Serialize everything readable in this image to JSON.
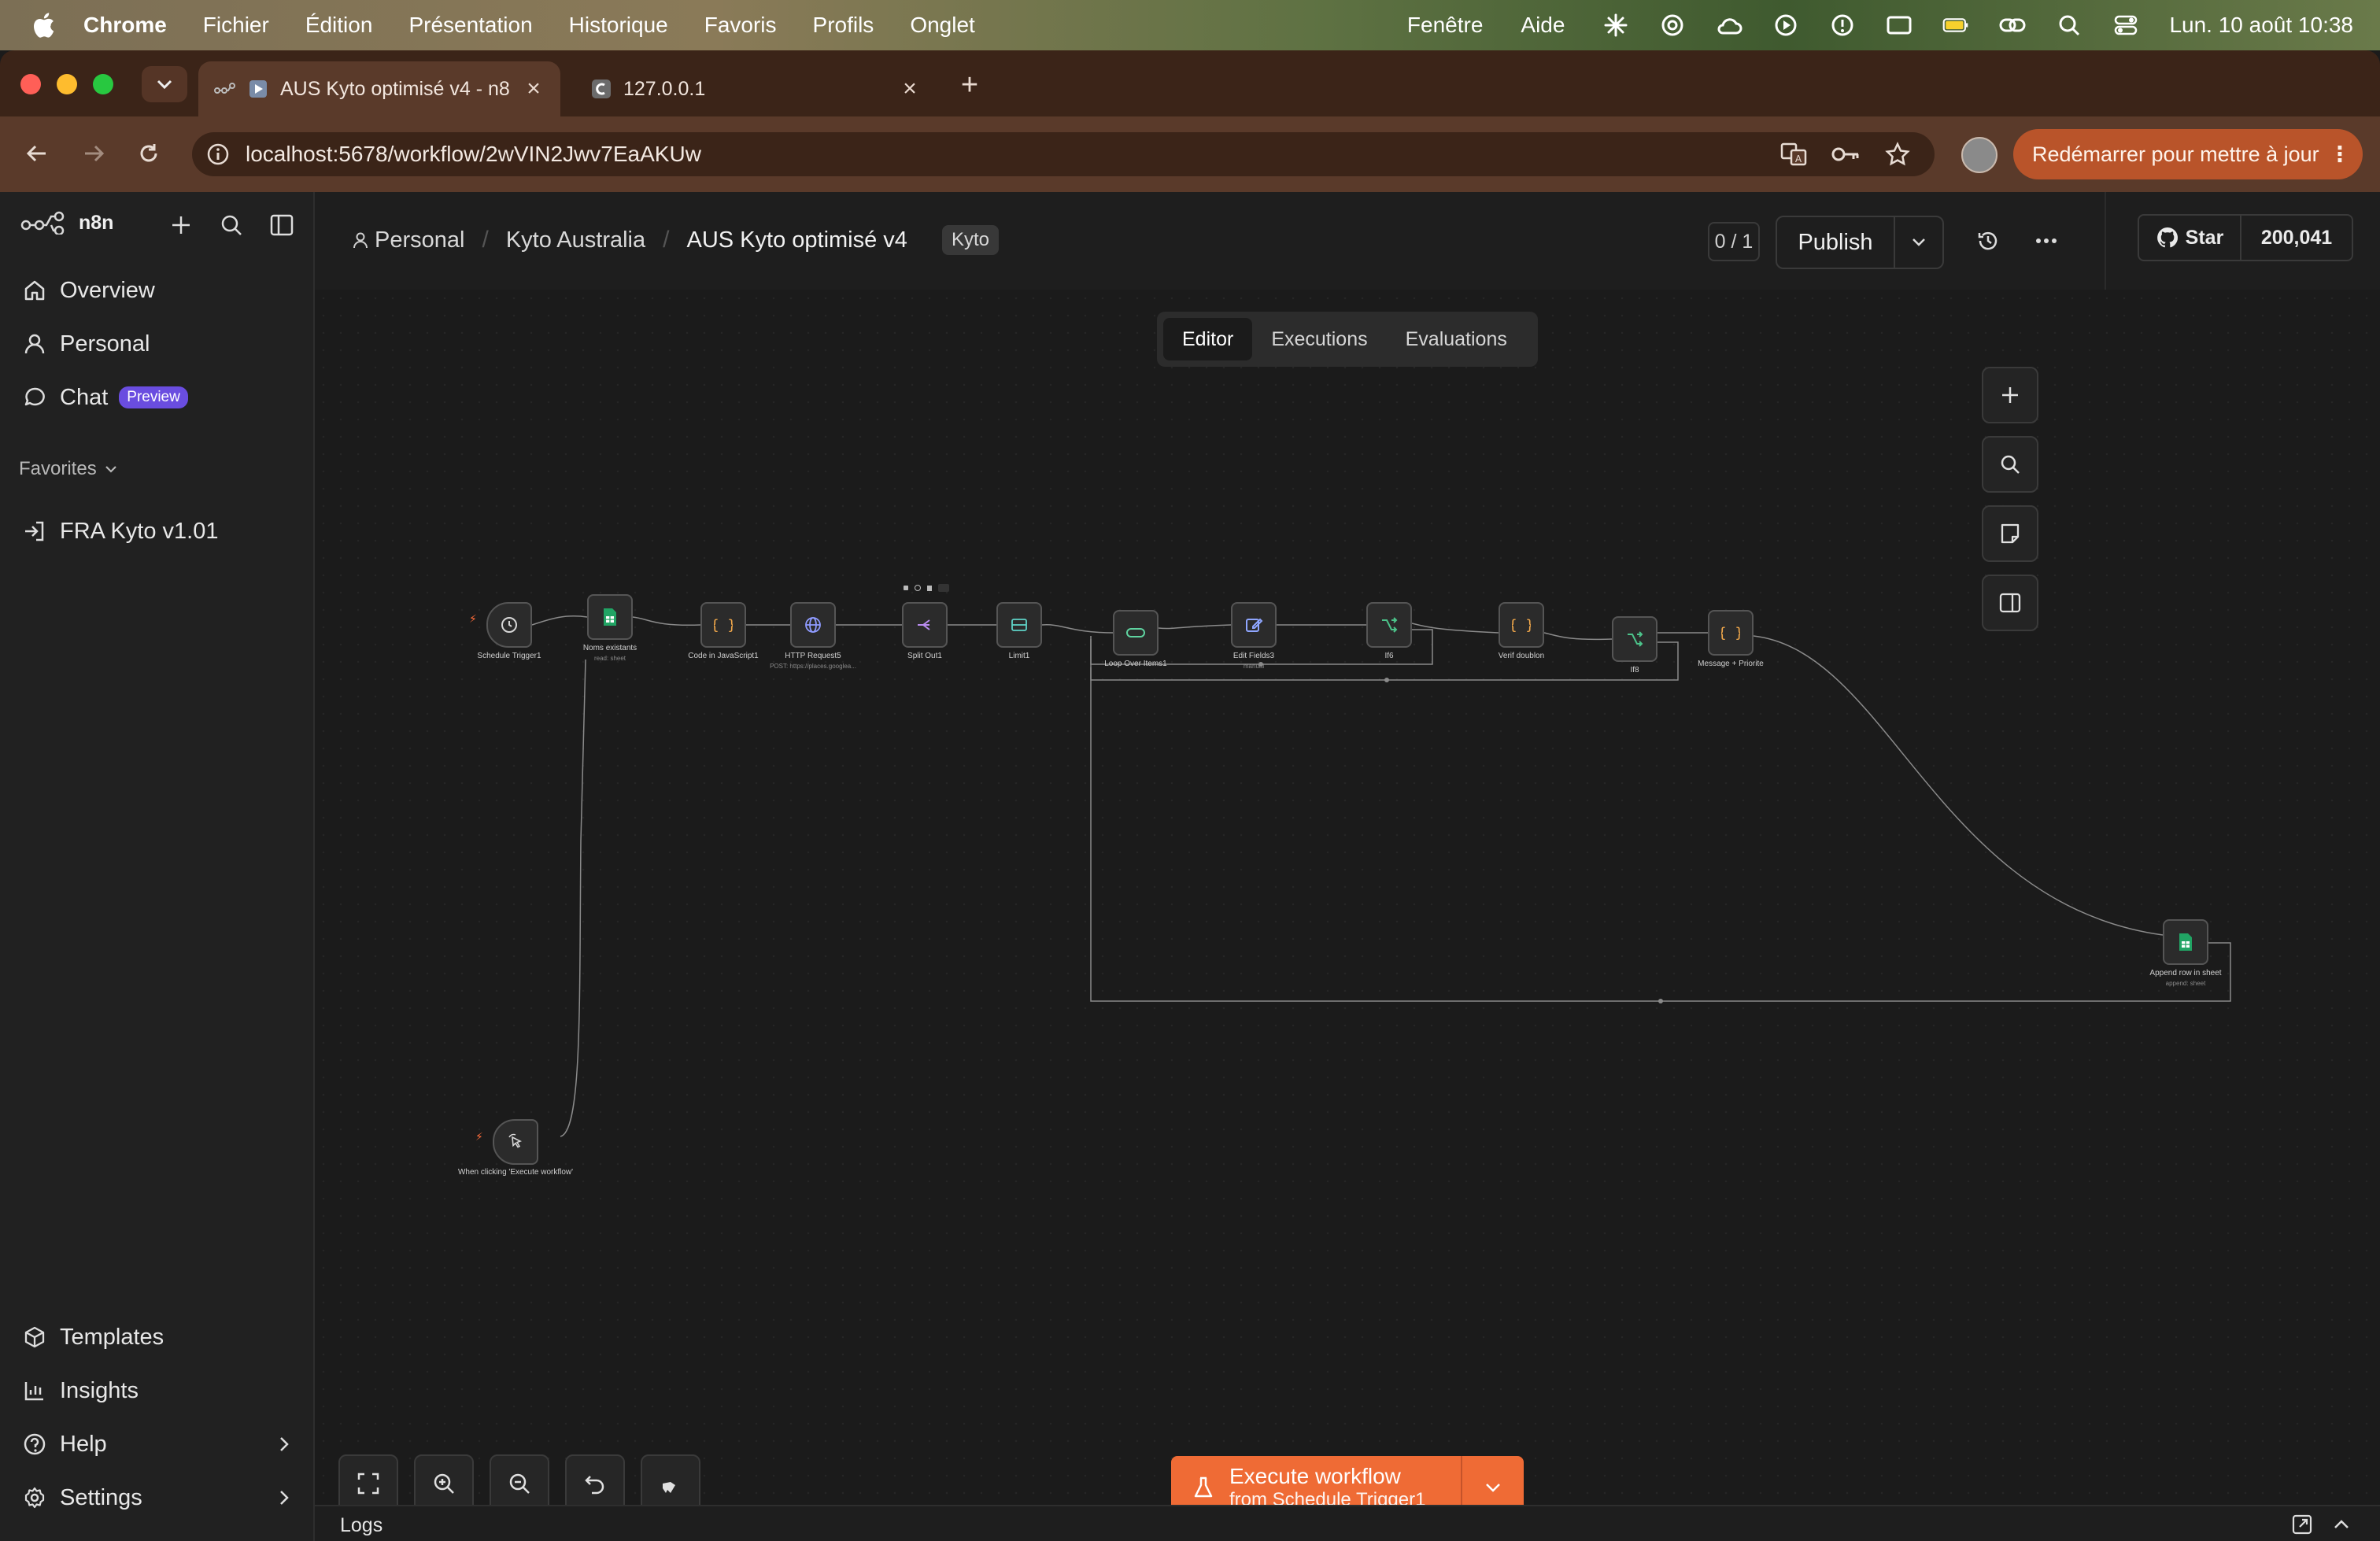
{
  "colors": {
    "accent": "#ef6b35",
    "menubar": "#6a6a45",
    "tabstrip": "#3b2418",
    "toolbar": "#5a3a2a",
    "canvas_bg": "#1b1b1b",
    "relaunch": "#b9542a",
    "preview_badge": "#6a4de0"
  },
  "menubar": {
    "app_name": "Chrome",
    "items": [
      "Fichier",
      "Édition",
      "Présentation",
      "Historique",
      "Favoris",
      "Profils",
      "Onglet"
    ],
    "right_items": [
      "Fenêtre",
      "Aide"
    ],
    "status_icons": [
      "brightness-icon",
      "chatgpt-icon",
      "cloud-icon",
      "play-icon",
      "alert-icon",
      "display-icon",
      "battery-icon",
      "link-icon",
      "search-icon",
      "control-center-icon"
    ],
    "clock": "Lun. 10 août  10:38"
  },
  "browser": {
    "tabs": [
      {
        "title": "AUS Kyto optimisé v4 - n8",
        "icon": "n8n-icon"
      },
      {
        "title": "127.0.0.1",
        "icon": "globe-icon"
      }
    ],
    "url": "localhost:5678/workflow/2wVIN2Jwv7EaAKUw",
    "relaunch_label": "Redémarrer pour mettre à jour"
  },
  "sidebar": {
    "brand": "n8n",
    "nav": [
      {
        "label": "Overview",
        "icon": "home-icon"
      },
      {
        "label": "Personal",
        "icon": "user-icon"
      },
      {
        "label": "Chat",
        "icon": "chat-icon",
        "badge": "Preview"
      }
    ],
    "favorites_label": "Favorites",
    "favorites": [
      {
        "label": "FRA Kyto v1.01",
        "icon": "sign-in-icon"
      }
    ],
    "bottom": [
      {
        "label": "Templates",
        "icon": "box-icon"
      },
      {
        "label": "Insights",
        "icon": "chart-icon"
      },
      {
        "label": "Help",
        "icon": "help-icon"
      },
      {
        "label": "Settings",
        "icon": "gear-icon"
      }
    ]
  },
  "header": {
    "breadcrumb": [
      "Personal",
      "Kyto Australia",
      "AUS Kyto optimisé v4"
    ],
    "tag": "Kyto",
    "counter": "0 / 1",
    "publish": "Publish",
    "github_label": "Star",
    "github_count": "200,041"
  },
  "view_tabs": [
    "Editor",
    "Executions",
    "Evaluations"
  ],
  "nodes": [
    {
      "label": "Schedule Trigger1",
      "sub": "",
      "icon": "clock-icon"
    },
    {
      "label": "Noms existants",
      "sub": "read: sheet",
      "icon": "sheets-icon"
    },
    {
      "label": "Code in JavaScript1",
      "sub": "",
      "icon": "code-icon"
    },
    {
      "label": "HTTP Request5",
      "sub": "POST: https://places.googleа...",
      "icon": "globe-icon"
    },
    {
      "label": "Split Out1",
      "sub": "",
      "icon": "split-icon"
    },
    {
      "label": "Limit1",
      "sub": "",
      "icon": "limit-icon"
    },
    {
      "label": "Loop Over Items1",
      "sub": "",
      "icon": "loop-icon"
    },
    {
      "label": "Edit Fields3",
      "sub": "manual",
      "icon": "edit-icon"
    },
    {
      "label": "If6",
      "sub": "",
      "icon": "if-icon"
    },
    {
      "label": "Verif doublon",
      "sub": "",
      "icon": "code-icon"
    },
    {
      "label": "If8",
      "sub": "",
      "icon": "if-icon"
    },
    {
      "label": "Message + Priorite",
      "sub": "",
      "icon": "code-icon"
    },
    {
      "label": "Append row in sheet",
      "sub": "append: sheet",
      "icon": "sheets-icon"
    },
    {
      "label": "When clicking 'Execute workflow'",
      "sub": "",
      "icon": "cursor-icon"
    }
  ],
  "execute": {
    "line1": "Execute workflow",
    "line2": "from Schedule Trigger1"
  },
  "logs_label": "Logs"
}
